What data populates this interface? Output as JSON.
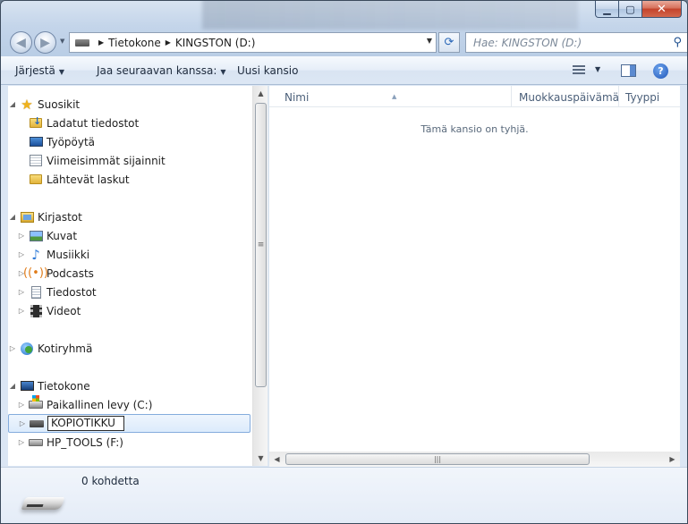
{
  "window": {
    "controls": {
      "minimize": "▁",
      "maximize": "▢",
      "close": "✕"
    }
  },
  "address": {
    "crumbs": [
      "Tietokone",
      "KINGSTON (D:)"
    ],
    "search_placeholder": "Hae: KINGSTON (D:)"
  },
  "toolbar": {
    "organize": "Järjestä",
    "share": "Jaa seuraavan kanssa:",
    "new_folder": "Uusi kansio"
  },
  "tree": {
    "favorites": "Suosikit",
    "downloads": "Ladatut tiedostot",
    "desktop": "Työpöytä",
    "recent": "Viimeisimmät sijainnit",
    "invoices": "Lähtevät laskut",
    "libraries": "Kirjastot",
    "pictures": "Kuvat",
    "music": "Musiikki",
    "podcasts": "Podcasts",
    "documents": "Tiedostot",
    "videos": "Videot",
    "homegroup": "Kotiryhmä",
    "computer": "Tietokone",
    "local_disk": "Paikallinen levy (C:)",
    "renaming_drive": "KOPIOTIKKU",
    "hp_tools": "HP_TOOLS (F:)"
  },
  "columns": [
    "Nimi",
    "Muokkauspäivämäärä",
    "Tyyppi"
  ],
  "content": {
    "empty_message": "Tämä kansio on tyhjä."
  },
  "details": {
    "item_count": "0 kohdetta"
  },
  "colors": {
    "selection": "#dcebfc",
    "selection_border": "#84acdd",
    "accent": "#1f56b8"
  }
}
